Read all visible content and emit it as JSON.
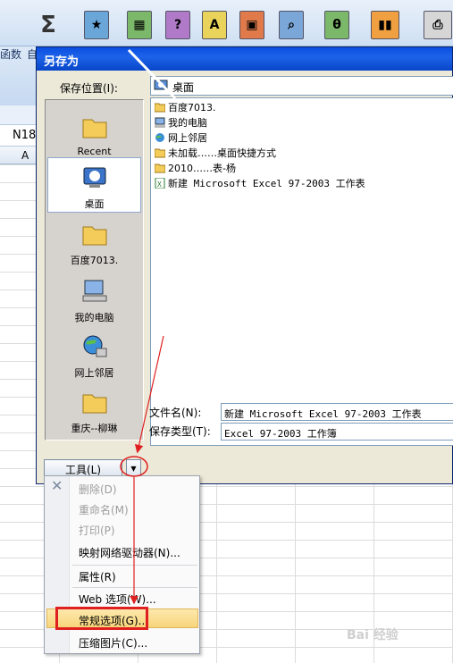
{
  "excel": {
    "side_label_top": "函数",
    "side_label_2": "自",
    "name_box": "N18",
    "column_a": "A"
  },
  "ribbon_icons": [
    "book-star-icon",
    "book-chart-icon",
    "book-question-icon",
    "book-a-icon",
    "book-image-icon",
    "book-search-icon",
    "book-theta-icon",
    "books-icon",
    "printer-icon"
  ],
  "sigma": "Σ",
  "dialog": {
    "title": "另存为",
    "location_label": "保存位置(I):",
    "location_value": "桌面",
    "places": [
      {
        "label": "Recent",
        "icon": "folder-icon"
      },
      {
        "label": "桌面",
        "icon": "desktop-icon",
        "selected": true
      },
      {
        "label": "百度7013.",
        "icon": "folder-icon"
      },
      {
        "label": "我的电脑",
        "icon": "computer-icon"
      },
      {
        "label": "网上邻居",
        "icon": "network-icon"
      },
      {
        "label": "重庆--柳琳",
        "icon": "folder-icon"
      }
    ],
    "files": [
      {
        "name": "百度7013.",
        "icon": "folder-icon"
      },
      {
        "name": "我的电脑",
        "icon": "computer-icon"
      },
      {
        "name": "网上邻居",
        "icon": "network-icon"
      },
      {
        "name": "未加载……桌面快捷方式",
        "icon": "folder-icon"
      },
      {
        "name": "2010……表-杨",
        "icon": "folder-icon"
      },
      {
        "name": "新建 Microsoft Excel 97-2003 工作表",
        "icon": "excel-file-icon"
      }
    ],
    "filename_label": "文件名(N):",
    "filename_value": "新建 Microsoft Excel 97-2003 工作表",
    "filetype_label": "保存类型(T):",
    "filetype_value": "Excel 97-2003 工作簿",
    "tools_label": "工具(L)"
  },
  "menu": {
    "items": [
      {
        "label": "删除(D)",
        "enabled": false
      },
      {
        "label": "重命名(M)",
        "enabled": false
      },
      {
        "label": "打印(P)",
        "enabled": false
      },
      {
        "label": "映射网络驱动器(N)...",
        "enabled": true
      },
      {
        "label": "属性(R)",
        "enabled": true
      },
      {
        "label": "Web 选项(W)...",
        "enabled": true
      },
      {
        "label": "常规选项(G)...",
        "enabled": true,
        "highlighted": true
      },
      {
        "label": "压缩图片(C)...",
        "enabled": true
      }
    ]
  },
  "watermark": "Bai 经验",
  "colors": {
    "title_bar": "#0a4ee0",
    "annotation": "#e02020",
    "highlight": "#f7d57a"
  }
}
